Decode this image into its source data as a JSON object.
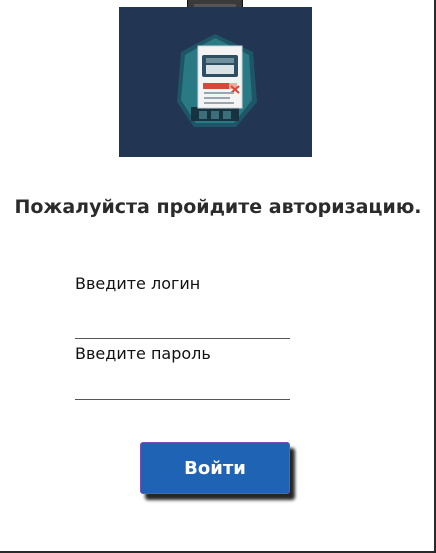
{
  "header": {
    "title": "Пожалуйста пройдите авторизацию."
  },
  "logo": {
    "icon": "document-scanner-icon",
    "background_color": "#223654"
  },
  "form": {
    "login_label": "Введите логин",
    "login_value": "",
    "password_label": "Введите пароль",
    "password_value": "",
    "submit_label": "Войти"
  },
  "colors": {
    "button": "#1f63b5",
    "button_border": "#7a4fb8",
    "title_text": "#2b2b2b"
  }
}
